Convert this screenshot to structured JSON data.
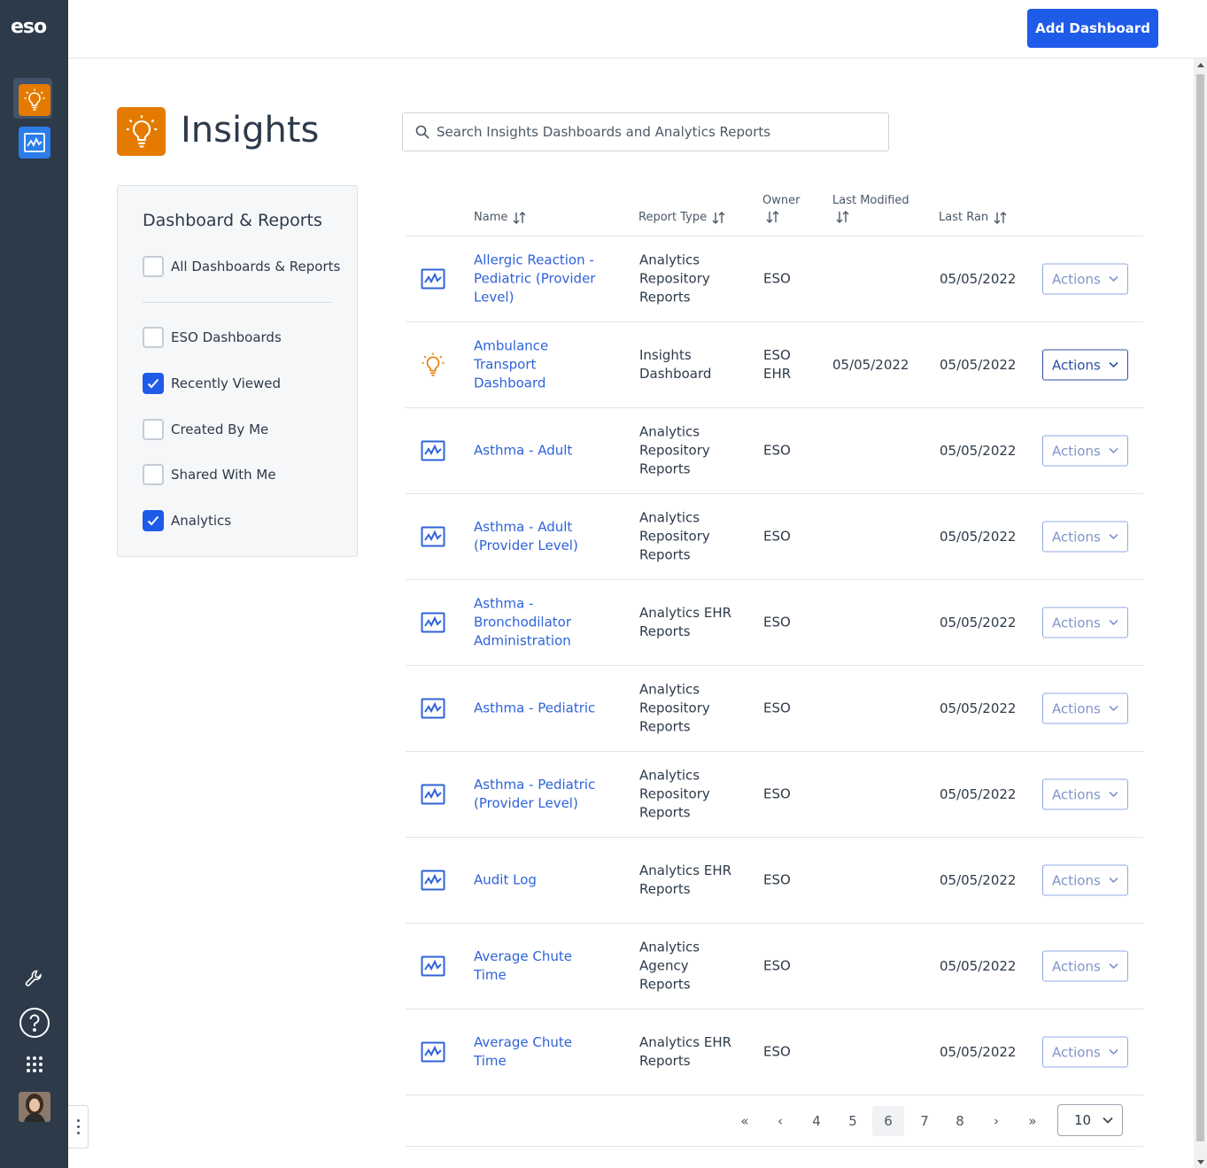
{
  "brand": {
    "logo": "eso"
  },
  "rail": {
    "apps": [
      {
        "name": "Insights",
        "icon": "lightbulb-icon",
        "color": "#e47b00",
        "selected": true
      },
      {
        "name": "Analytics",
        "icon": "analytics-chart-icon",
        "color": "#2b7de9",
        "selected": false
      }
    ],
    "bottom_icons": [
      "wrench-icon",
      "help-icon",
      "app-grid-icon",
      "user-avatar"
    ]
  },
  "topbar": {
    "add_dashboard_label": "Add Dashboard"
  },
  "header": {
    "title": "Insights"
  },
  "search": {
    "placeholder": "Search Insights Dashboards and Analytics Reports",
    "value": ""
  },
  "filters": {
    "title": "Dashboard & Reports",
    "all": {
      "label": "All Dashboards & Reports",
      "checked": false
    },
    "items": [
      {
        "label": "ESO Dashboards",
        "checked": false
      },
      {
        "label": "Recently Viewed",
        "checked": true
      },
      {
        "label": "Created By Me",
        "checked": false
      },
      {
        "label": "Shared With Me",
        "checked": false
      },
      {
        "label": "Analytics",
        "checked": true
      }
    ]
  },
  "table": {
    "columns": {
      "name": "Name",
      "report_type": "Report Type",
      "owner": "Owner",
      "last_modified": "Last Modified",
      "last_ran": "Last Ran"
    },
    "actions_label": "Actions",
    "rows": [
      {
        "icon": "analytics-chart-icon",
        "name": "Allergic Reaction - Pediatric (Provider Level)",
        "report_type": "Analytics Repository Reports",
        "owner": "ESO",
        "last_modified": "",
        "last_ran": "05/05/2022",
        "active": false
      },
      {
        "icon": "lightbulb-icon",
        "name": "Ambulance Transport Dashboard",
        "report_type": "Insights Dashboard",
        "owner": "ESO EHR",
        "last_modified": "05/05/2022",
        "last_ran": "05/05/2022",
        "active": true
      },
      {
        "icon": "analytics-chart-icon",
        "name": "Asthma - Adult",
        "report_type": "Analytics Repository Reports",
        "owner": "ESO",
        "last_modified": "",
        "last_ran": "05/05/2022",
        "active": false
      },
      {
        "icon": "analytics-chart-icon",
        "name": "Asthma - Adult (Provider Level)",
        "report_type": "Analytics Repository Reports",
        "owner": "ESO",
        "last_modified": "",
        "last_ran": "05/05/2022",
        "active": false
      },
      {
        "icon": "analytics-chart-icon",
        "name": "Asthma - Bronchodilator Administration",
        "report_type": "Analytics EHR Reports",
        "owner": "ESO",
        "last_modified": "",
        "last_ran": "05/05/2022",
        "active": false
      },
      {
        "icon": "analytics-chart-icon",
        "name": "Asthma - Pediatric",
        "report_type": "Analytics Repository Reports",
        "owner": "ESO",
        "last_modified": "",
        "last_ran": "05/05/2022",
        "active": false
      },
      {
        "icon": "analytics-chart-icon",
        "name": "Asthma - Pediatric (Provider Level)",
        "report_type": "Analytics Repository Reports",
        "owner": "ESO",
        "last_modified": "",
        "last_ran": "05/05/2022",
        "active": false
      },
      {
        "icon": "analytics-chart-icon",
        "name": "Audit Log",
        "report_type": "Analytics EHR Reports",
        "owner": "ESO",
        "last_modified": "",
        "last_ran": "05/05/2022",
        "active": false
      },
      {
        "icon": "analytics-chart-icon",
        "name": "Average Chute Time",
        "report_type": "Analytics Agency Reports",
        "owner": "ESO",
        "last_modified": "",
        "last_ran": "05/05/2022",
        "active": false
      },
      {
        "icon": "analytics-chart-icon",
        "name": "Average Chute Time",
        "report_type": "Analytics EHR Reports",
        "owner": "ESO",
        "last_modified": "",
        "last_ran": "05/05/2022",
        "active": false
      }
    ]
  },
  "pagination": {
    "first": "«",
    "prev": "‹",
    "pages": [
      "4",
      "5",
      "6",
      "7",
      "8"
    ],
    "current": "6",
    "next": "›",
    "last": "»",
    "page_size": "10"
  }
}
